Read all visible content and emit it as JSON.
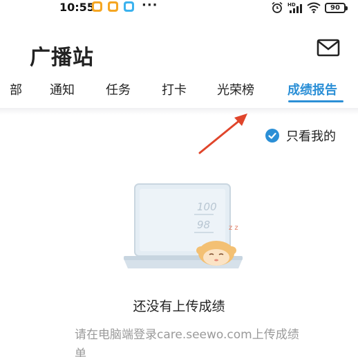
{
  "status_bar": {
    "time": "10:55",
    "signal_label": "HD",
    "battery": "90"
  },
  "header": {
    "title": "广播站"
  },
  "tabs": [
    {
      "label": "部"
    },
    {
      "label": "通知"
    },
    {
      "label": "任务"
    },
    {
      "label": "打卡"
    },
    {
      "label": "光荣榜"
    },
    {
      "label": "成绩报告",
      "active": true
    }
  ],
  "filter": {
    "label": "只看我的",
    "checked": true
  },
  "illustration": {
    "score_top": "100",
    "score_bottom": "98",
    "sleep_text": "z z"
  },
  "empty_state": {
    "title": "还没有上传成绩",
    "description": "请在电脑端登录care.seewo.com上传成绩单"
  },
  "colors": {
    "accent": "#2b8fd6",
    "arrow": "#e0452b"
  }
}
